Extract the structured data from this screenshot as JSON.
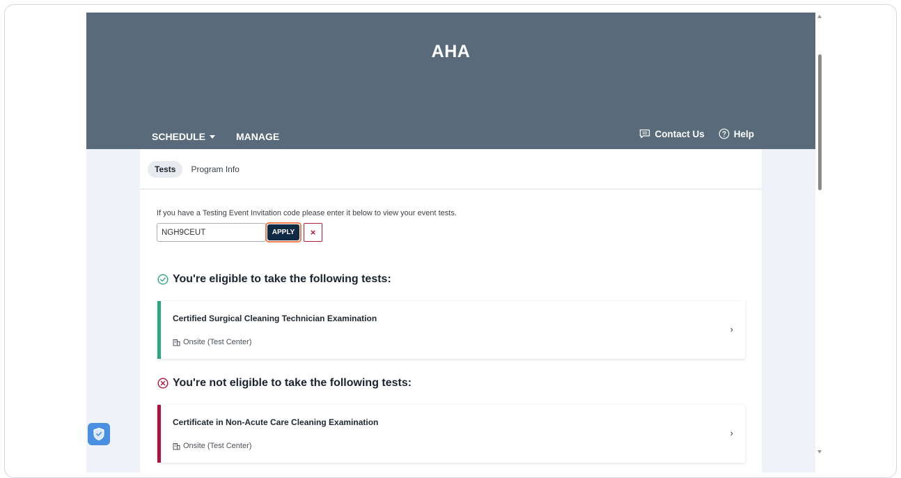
{
  "header": {
    "brand": "AHA",
    "nav": {
      "schedule": "SCHEDULE",
      "manage": "MANAGE"
    },
    "utilities": {
      "contact": "Contact Us",
      "help": "Help"
    }
  },
  "tabs": [
    {
      "label": "Tests",
      "active": true
    },
    {
      "label": "Program Info",
      "active": false
    }
  ],
  "invitation": {
    "prompt": "If you have a Testing Event Invitation code please enter it below to view your event tests.",
    "code_value": "NGH9CEUT",
    "apply_label": "APPLY",
    "clear_label": "×"
  },
  "eligible": {
    "heading": "You're eligible to take the following tests:",
    "status_color": "#2ba77a",
    "tests": [
      {
        "title": "Certified Surgical Cleaning Technician Examination",
        "mode": "Onsite (Test Center)"
      }
    ]
  },
  "ineligible": {
    "heading": "You're not eligible to take the following tests:",
    "status_color": "#b0123a",
    "tests": [
      {
        "title": "Certificate in Non-Acute Care Cleaning Examination",
        "mode": "Onsite (Test Center)"
      }
    ]
  },
  "chevron": "›",
  "icons": {
    "contact": "message-icon",
    "help": "help-circle-icon",
    "eligible": "check-circle-icon",
    "ineligible": "x-circle-icon",
    "mode": "building-icon",
    "privacy": "shield-check-icon"
  },
  "colors": {
    "banner": "#596a7a",
    "page_bg": "#eff3f9",
    "apply_button": "#102a43",
    "apply_focus": "#f07a4a"
  }
}
